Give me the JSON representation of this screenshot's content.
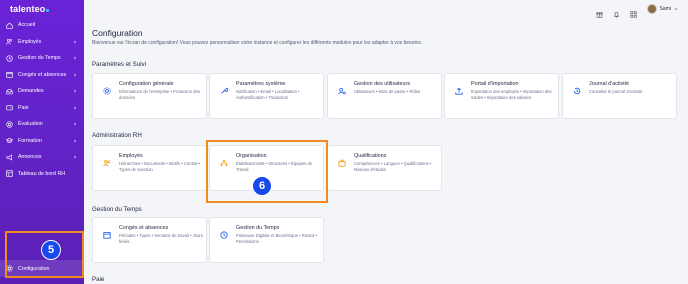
{
  "brand": {
    "name": "talenteo"
  },
  "sidebar": {
    "items": [
      {
        "label": "Accueil",
        "icon": "home-icon",
        "chevron": false
      },
      {
        "label": "Employés",
        "icon": "users-icon",
        "chevron": true
      },
      {
        "label": "Gestion du Temps",
        "icon": "clock-icon",
        "chevron": true
      },
      {
        "label": "Congés et absences",
        "icon": "calendar-icon",
        "chevron": true
      },
      {
        "label": "Demandes",
        "icon": "inbox-icon",
        "chevron": true
      },
      {
        "label": "Paie",
        "icon": "wallet-icon",
        "chevron": true
      },
      {
        "label": "Évaluation",
        "icon": "target-icon",
        "chevron": true
      },
      {
        "label": "Formation",
        "icon": "graduation-icon",
        "chevron": true
      },
      {
        "label": "Annonces",
        "icon": "megaphone-icon",
        "chevron": true
      },
      {
        "label": "Tableau de bord RH",
        "icon": "dashboard-icon",
        "chevron": false
      }
    ],
    "config_label": "Configuration"
  },
  "topbar": {
    "user_name": "Sami"
  },
  "page": {
    "title": "Configuration",
    "subtitle": "Bienvenue sur l'écran de configuration! Vous pouvez personnaliser votre instance et configurer les différents modules pour les adapter à vos besoins."
  },
  "sections": [
    {
      "title": "Paramètres et Suivi",
      "cards": [
        {
          "title": "Configuration générale",
          "desc": "Informations de l'entreprise • Protection des données",
          "icon": "settings-icon"
        },
        {
          "title": "Paramètres système",
          "desc": "Notification • Email • Localisation • Authentification • Traduction",
          "icon": "wrench-icon"
        },
        {
          "title": "Gestion des utilisateurs",
          "desc": "Utilisateurs • Mots de passe • Rôles",
          "icon": "user-gear-icon"
        },
        {
          "title": "Portail d'importation",
          "desc": "Importation des employés • Importation des soldes • Importation des salaires",
          "icon": "upload-icon"
        },
        {
          "title": "Journal d'activité",
          "desc": "Consulter le journal d'activité",
          "icon": "history-icon"
        }
      ]
    },
    {
      "title": "Administration RH",
      "cards": [
        {
          "title": "Employés",
          "desc": "Hiérarchies • Documents • Motifs • Contrat • Types de sanction",
          "icon": "employees-icon"
        },
        {
          "title": "Organisation",
          "desc": "Établissements • Structures • Équipes de Travail",
          "icon": "org-chart-icon"
        },
        {
          "title": "Qualifications",
          "desc": "Compétences • Langues • Qualifications • Niveaux d'études",
          "icon": "briefcase-icon"
        }
      ]
    },
    {
      "title": "Gestion du Temps",
      "cards": [
        {
          "title": "Congés et absences",
          "desc": "Périodes • Types • Semaine de travail • Jours fériés",
          "icon": "calendar-icon"
        },
        {
          "title": "Gestion du Temps",
          "desc": "Pointeuse Digitale et Biométrique • Retard • Permissions",
          "icon": "time-icon"
        }
      ]
    },
    {
      "title": "Paie",
      "cards": []
    }
  ],
  "annotations": {
    "sidebar_step": "5",
    "card_step": "6"
  },
  "colors": {
    "sidebar": "#6a22d8",
    "highlight": "#f28a1f",
    "badge": "#1749ec",
    "card_icon": "#2563eb",
    "card_icon_alt": "#f59e0b"
  }
}
